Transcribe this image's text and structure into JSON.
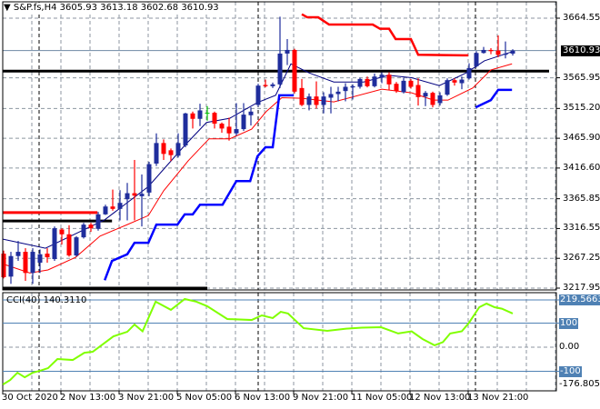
{
  "header": {
    "symbol": "S&P.fs,H4",
    "open": "3605.93",
    "high": "3613.18",
    "low": "3602.68",
    "close": "3610.93"
  },
  "colors": {
    "bull": "#1f2d9c",
    "bear": "#ff0000",
    "doji": "#00c000",
    "ma_fast": "#000080",
    "ma_slow": "#ff0000",
    "channel_low": "#0000ff",
    "channel_high": "#ff0000",
    "cci": "#80ff00",
    "level": "#4f81b4"
  },
  "chart_data": {
    "type": "candlestick",
    "title": "S&P.fs,H4",
    "price_axis": {
      "ticks": [
        "3664.55",
        "3565.95",
        "3515.20",
        "3465.90",
        "3416.60",
        "3365.85",
        "3316.55",
        "3267.25",
        "3217.95"
      ],
      "last_price": "3610.93",
      "range": [
        3217.95,
        3664.55
      ]
    },
    "time_axis": {
      "ticks": [
        "30 Oct 2020",
        "2 Nov 13:00",
        "3 Nov 21:00",
        "5 Nov 05:00",
        "6 Nov 13:00",
        "9 Nov 21:00",
        "11 Nov 05:00",
        "12 Nov 13:00",
        "13 Nov 21:00"
      ],
      "candles_per_tick": 8
    },
    "candles_ohlc": [
      [
        3275,
        3280,
        3234,
        3236
      ],
      [
        3237,
        3278,
        3225,
        3271
      ],
      [
        3271,
        3296,
        3263,
        3278
      ],
      [
        3278,
        3284,
        3230,
        3243
      ],
      [
        3243,
        3284,
        3225,
        3278
      ],
      [
        3260,
        3282,
        3243,
        3274
      ],
      [
        3275,
        3284,
        3260,
        3269
      ],
      [
        3266,
        3320,
        3263,
        3317
      ],
      [
        3315,
        3317,
        3290,
        3307
      ],
      [
        3307,
        3322,
        3270,
        3272
      ],
      [
        3272,
        3304,
        3270,
        3302
      ],
      [
        3302,
        3326,
        3300,
        3323
      ],
      [
        3323,
        3326,
        3311,
        3317
      ],
      [
        3316,
        3344,
        3313,
        3340
      ],
      [
        3340,
        3356,
        3339,
        3353
      ],
      [
        3353,
        3381,
        3346,
        3349
      ],
      [
        3349,
        3380,
        3330,
        3359
      ],
      [
        3365,
        3392,
        3330,
        3375
      ],
      [
        3375,
        3430,
        3330,
        3371
      ],
      [
        3370,
        3406,
        3320,
        3374
      ],
      [
        3376,
        3427,
        3370,
        3423
      ],
      [
        3424,
        3474,
        3420,
        3458
      ],
      [
        3458,
        3464,
        3430,
        3440
      ],
      [
        3446,
        3449,
        3428,
        3438
      ],
      [
        3437,
        3474,
        3434,
        3458
      ],
      [
        3454,
        3508,
        3451,
        3507
      ],
      [
        3507,
        3510,
        3482,
        3498
      ],
      [
        3498,
        3523,
        3486,
        3512
      ],
      [
        3508,
        3519,
        3495,
        3508
      ],
      [
        3508,
        3510,
        3482,
        3490
      ],
      [
        3490,
        3492,
        3475,
        3482
      ],
      [
        3485,
        3500,
        3462,
        3474
      ],
      [
        3474,
        3524,
        3470,
        3481
      ],
      [
        3481,
        3524,
        3478,
        3505
      ],
      [
        3504,
        3517,
        3487,
        3510
      ],
      [
        3521,
        3556,
        3518,
        3553
      ],
      [
        3554,
        3563,
        3550,
        3552
      ],
      [
        3552,
        3558,
        3549,
        3555
      ],
      [
        3555,
        3667,
        3549,
        3606
      ],
      [
        3606,
        3630,
        3587,
        3612
      ],
      [
        3612,
        3614,
        3540,
        3543
      ],
      [
        3549,
        3564,
        3519,
        3521
      ],
      [
        3521,
        3540,
        3512,
        3535
      ],
      [
        3535,
        3560,
        3515,
        3521
      ],
      [
        3521,
        3542,
        3507,
        3535
      ],
      [
        3533,
        3551,
        3507,
        3539
      ],
      [
        3539,
        3551,
        3527,
        3543
      ],
      [
        3544,
        3557,
        3527,
        3551
      ],
      [
        3550,
        3555,
        3530,
        3552
      ],
      [
        3551,
        3566,
        3548,
        3564
      ],
      [
        3564,
        3568,
        3550,
        3552
      ],
      [
        3552,
        3573,
        3550,
        3568
      ],
      [
        3566,
        3575,
        3557,
        3571
      ],
      [
        3571,
        3575,
        3545,
        3555
      ],
      [
        3556,
        3559,
        3541,
        3544
      ],
      [
        3542,
        3566,
        3540,
        3561
      ],
      [
        3561,
        3564,
        3548,
        3551
      ],
      [
        3554,
        3565,
        3520,
        3534
      ],
      [
        3535,
        3544,
        3519,
        3541
      ],
      [
        3541,
        3543,
        3517,
        3521
      ],
      [
        3524,
        3542,
        3520,
        3537
      ],
      [
        3538,
        3565,
        3536,
        3562
      ],
      [
        3562,
        3565,
        3553,
        3558
      ],
      [
        3557,
        3568,
        3547,
        3563
      ],
      [
        3565,
        3590,
        3563,
        3582
      ],
      [
        3585,
        3610,
        3583,
        3607
      ],
      [
        3607,
        3617,
        3606,
        3612
      ],
      [
        3612,
        3615,
        3605,
        3610
      ],
      [
        3611,
        3636,
        3600,
        3604
      ],
      [
        3604,
        3626,
        3598,
        3606
      ],
      [
        3605.93,
        3613.18,
        3602.68,
        3610.93
      ]
    ],
    "doji_highlight_index": 28,
    "overlays": {
      "ma_fast": [
        [
          -0.1,
          3299
        ],
        [
          5.75,
          3284
        ],
        [
          13.9,
          3331
        ],
        [
          19.9,
          3386
        ],
        [
          24.9,
          3454
        ],
        [
          27.9,
          3492
        ],
        [
          31.1,
          3499
        ],
        [
          34.9,
          3525
        ],
        [
          37.4,
          3537
        ],
        [
          39.5,
          3589
        ],
        [
          42,
          3574
        ],
        [
          45.4,
          3559
        ],
        [
          49.5,
          3559
        ],
        [
          52.9,
          3570
        ],
        [
          56.1,
          3566
        ],
        [
          59.9,
          3553
        ],
        [
          63.6,
          3574
        ],
        [
          66.1,
          3594
        ],
        [
          69.9,
          3609
        ]
      ],
      "ma_slow": [
        [
          -0.1,
          3258
        ],
        [
          3.6,
          3243
        ],
        [
          6.1,
          3248
        ],
        [
          9.9,
          3269
        ],
        [
          13.25,
          3304
        ],
        [
          17,
          3323
        ],
        [
          19.9,
          3338
        ],
        [
          22,
          3379
        ],
        [
          25.4,
          3429
        ],
        [
          28.25,
          3465
        ],
        [
          31.1,
          3465
        ],
        [
          34.1,
          3481
        ],
        [
          36.1,
          3510
        ],
        [
          38.25,
          3533
        ],
        [
          41,
          3532
        ],
        [
          45.4,
          3526
        ],
        [
          52,
          3547
        ],
        [
          56.1,
          3541
        ],
        [
          59.1,
          3529
        ],
        [
          61.1,
          3529
        ],
        [
          64.5,
          3549
        ],
        [
          67,
          3579
        ],
        [
          69.9,
          3589
        ]
      ],
      "channel_low": [
        [
          [
            13.9,
            3231
          ],
          [
            14.9,
            3263
          ],
          [
            17,
            3274
          ],
          [
            18,
            3293
          ],
          [
            19.9,
            3293
          ],
          [
            21,
            3323
          ],
          [
            23.9,
            3323
          ],
          [
            24.9,
            3340
          ],
          [
            26,
            3340
          ],
          [
            27,
            3356
          ],
          [
            30.1,
            3356
          ],
          [
            32,
            3395
          ],
          [
            33.9,
            3395
          ],
          [
            34.9,
            3436
          ],
          [
            36,
            3451
          ],
          [
            37,
            3451
          ],
          [
            37.9,
            3537
          ],
          [
            39.9,
            3537
          ]
        ],
        [
          [
            64.9,
            3517
          ],
          [
            67,
            3529
          ],
          [
            68,
            3546
          ],
          [
            69.9,
            3546
          ]
        ]
      ],
      "channel_high": [
        [
          41,
          3671
        ],
        [
          41.75,
          3666
        ],
        [
          43.25,
          3666
        ],
        [
          44.75,
          3654
        ],
        [
          50.75,
          3654
        ],
        [
          51.75,
          3647
        ],
        [
          53,
          3647
        ],
        [
          53.9,
          3630
        ],
        [
          56,
          3630
        ],
        [
          57,
          3604
        ],
        [
          63.9,
          3603
        ]
      ],
      "levels": [
        {
          "price": 3577,
          "from": -0.5,
          "to": 75,
          "color": "#000000"
        },
        {
          "price": 3343,
          "from": -0.5,
          "to": 12.9,
          "color": "#ff0000"
        },
        {
          "price": 3329,
          "from": -0.5,
          "to": 14.9,
          "color": "#000000"
        },
        {
          "price": 3218,
          "from": -0.5,
          "to": 28,
          "color": "#000000"
        }
      ]
    },
    "cci": {
      "label": "CCI(40) 140.3110",
      "period": 40,
      "current": 140.311,
      "range": [
        -176.8052,
        219.5663
      ],
      "levels": [
        219.5663,
        100,
        -100
      ],
      "ticks": [
        "219.5663",
        "100",
        "0.00",
        "-100",
        "-176.8052"
      ],
      "points": [
        [
          -0.1,
          -155
        ],
        [
          0.9,
          -136
        ],
        [
          1.9,
          -106
        ],
        [
          2.9,
          -125
        ],
        [
          4,
          -106
        ],
        [
          5,
          -98
        ],
        [
          6.1,
          -87
        ],
        [
          7.4,
          -49
        ],
        [
          9.5,
          -53
        ],
        [
          11.1,
          -23
        ],
        [
          12.25,
          -19
        ],
        [
          15.1,
          45
        ],
        [
          17,
          64
        ],
        [
          18,
          94
        ],
        [
          19.1,
          66
        ],
        [
          20.9,
          189
        ],
        [
          23,
          155
        ],
        [
          24.9,
          200
        ],
        [
          26.5,
          189
        ],
        [
          28,
          170
        ],
        [
          30.75,
          117
        ],
        [
          34.1,
          113
        ],
        [
          35.5,
          132
        ],
        [
          37,
          121
        ],
        [
          38.1,
          147
        ],
        [
          39.1,
          140
        ],
        [
          41.25,
          79
        ],
        [
          44.5,
          68
        ],
        [
          47.1,
          77
        ],
        [
          49.25,
          81
        ],
        [
          51.9,
          83
        ],
        [
          54.25,
          57
        ],
        [
          56.1,
          66
        ],
        [
          57.6,
          34
        ],
        [
          59.25,
          8
        ],
        [
          60.4,
          21
        ],
        [
          61.4,
          57
        ],
        [
          63,
          66
        ],
        [
          64,
          102
        ],
        [
          65.4,
          166
        ],
        [
          66.4,
          181
        ],
        [
          67.5,
          166
        ],
        [
          68.5,
          160
        ],
        [
          70,
          140
        ]
      ]
    }
  }
}
